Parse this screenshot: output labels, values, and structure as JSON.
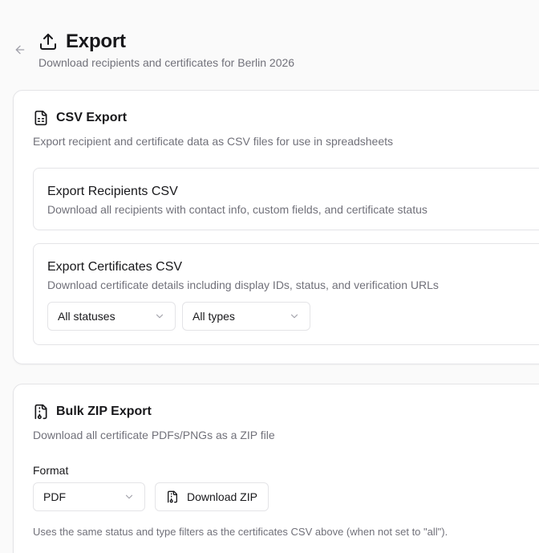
{
  "header": {
    "title": "Export",
    "subtitle": "Download recipients and certificates for Berlin 2026",
    "back_icon": "arrow-left-icon",
    "title_icon": "upload-icon"
  },
  "csv_export": {
    "title": "CSV Export",
    "description": "Export recipient and certificate data as CSV files for use in spreadsheets",
    "icon": "file-spreadsheet-icon",
    "recipients": {
      "title": "Export Recipients CSV",
      "description": "Download all recipients with contact info, custom fields, and certificate status"
    },
    "certificates": {
      "title": "Export Certificates CSV",
      "description": "Download certificate details including display IDs, status, and verification URLs",
      "status_filter": "All statuses",
      "type_filter": "All types"
    }
  },
  "zip_export": {
    "title": "Bulk ZIP Export",
    "description": "Download all certificate PDFs/PNGs as a ZIP file",
    "icon": "file-archive-icon",
    "format_label": "Format",
    "format_value": "PDF",
    "download_label": "Download ZIP",
    "note": "Uses the same status and type filters as the certificates CSV above (when not set to \"all\")."
  },
  "colors": {
    "text": "#18181b",
    "muted": "#71717a",
    "border": "#e4e4e7",
    "background": "#fafafa"
  }
}
